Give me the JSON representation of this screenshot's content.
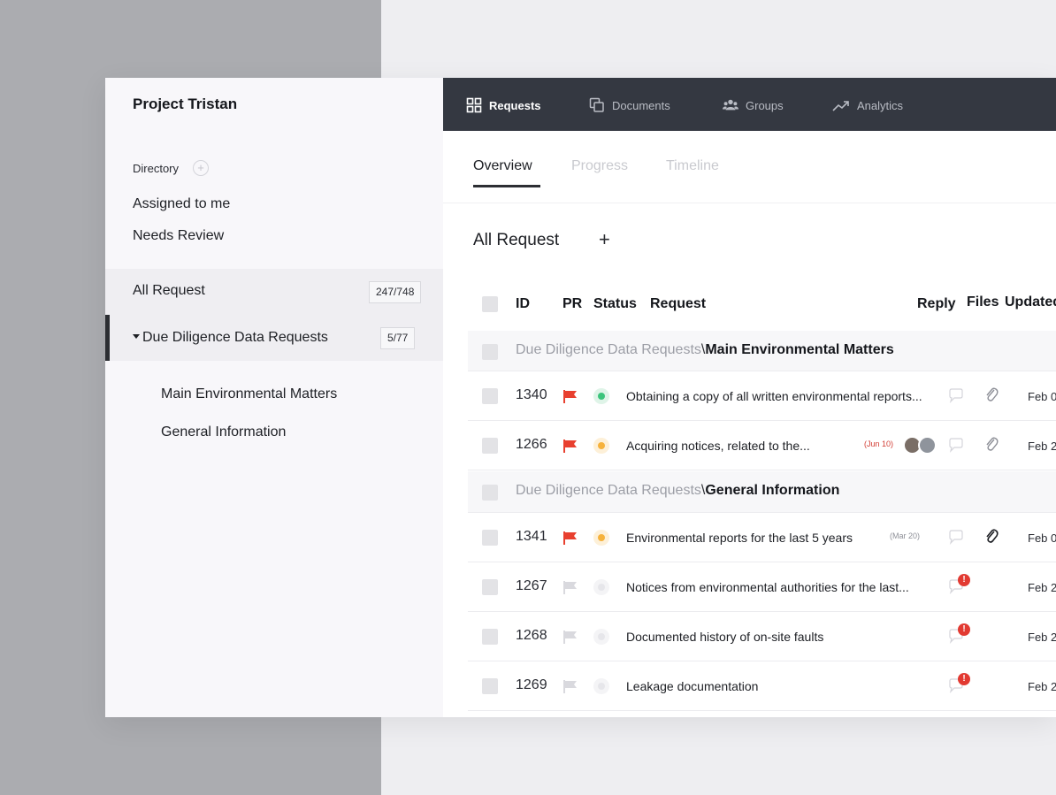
{
  "sidebar": {
    "project_title": "Project Tristan",
    "directory_label": "Directory",
    "directory_add": "+",
    "links": [
      "Assigned to me",
      "Needs Review"
    ],
    "all_request": {
      "label": "All Request",
      "count": "247/748"
    },
    "due_diligence": {
      "label": "Due Diligence Data Requests",
      "count": "5/77"
    },
    "sub_items": [
      "Main Environmental Matters",
      "General Information"
    ]
  },
  "topnav": {
    "items": [
      {
        "label": "Requests",
        "icon": "grid-icon",
        "active": true
      },
      {
        "label": "Documents",
        "icon": "copy-icon",
        "active": false
      },
      {
        "label": "Groups",
        "icon": "users-icon",
        "active": false
      },
      {
        "label": "Analytics",
        "icon": "trend-icon",
        "active": false
      }
    ]
  },
  "tabs": [
    "Overview",
    "Progress",
    "Timeline"
  ],
  "section": {
    "title": "All Request",
    "add": "+"
  },
  "table": {
    "headers": {
      "id": "ID",
      "pr": "PR",
      "status": "Status",
      "request": "Request",
      "reply": "Reply",
      "files": "Files",
      "updated": "Updated"
    },
    "groups": [
      {
        "parent": "Due Diligence Data Requests",
        "sep": "\\",
        "child": "Main Environmental Matters"
      },
      {
        "parent": "Due Diligence Data Requests",
        "sep": "\\",
        "child": "General Information"
      }
    ],
    "rows": [
      {
        "id": "1340",
        "request": "Obtaining a copy of all written environmental reports...",
        "due": "",
        "updated": "Feb 0"
      },
      {
        "id": "1266",
        "request": "Acquiring notices, related to the...",
        "due": "(Jun 10)",
        "updated": "Feb 2"
      },
      {
        "id": "1341",
        "request": "Environmental reports for the last 5 years",
        "due": "(Mar 20)",
        "updated": "Feb 0"
      },
      {
        "id": "1267",
        "request": "Notices from environmental authorities for the last...",
        "due": "",
        "updated": "Feb 2"
      },
      {
        "id": "1268",
        "request": "Documented history of on-site faults",
        "due": "",
        "updated": "Feb 2"
      },
      {
        "id": "1269",
        "request": "Leakage documentation",
        "due": "",
        "updated": "Feb 2"
      }
    ],
    "alert_mark": "!"
  },
  "colors": {
    "flag_red": "#e8402f",
    "flag_gray": "#d9d9de",
    "status_green": "#3cc47c",
    "status_orange": "#f6b23c",
    "status_gray": "#e6e6ea",
    "nav_bg": "#343841"
  }
}
